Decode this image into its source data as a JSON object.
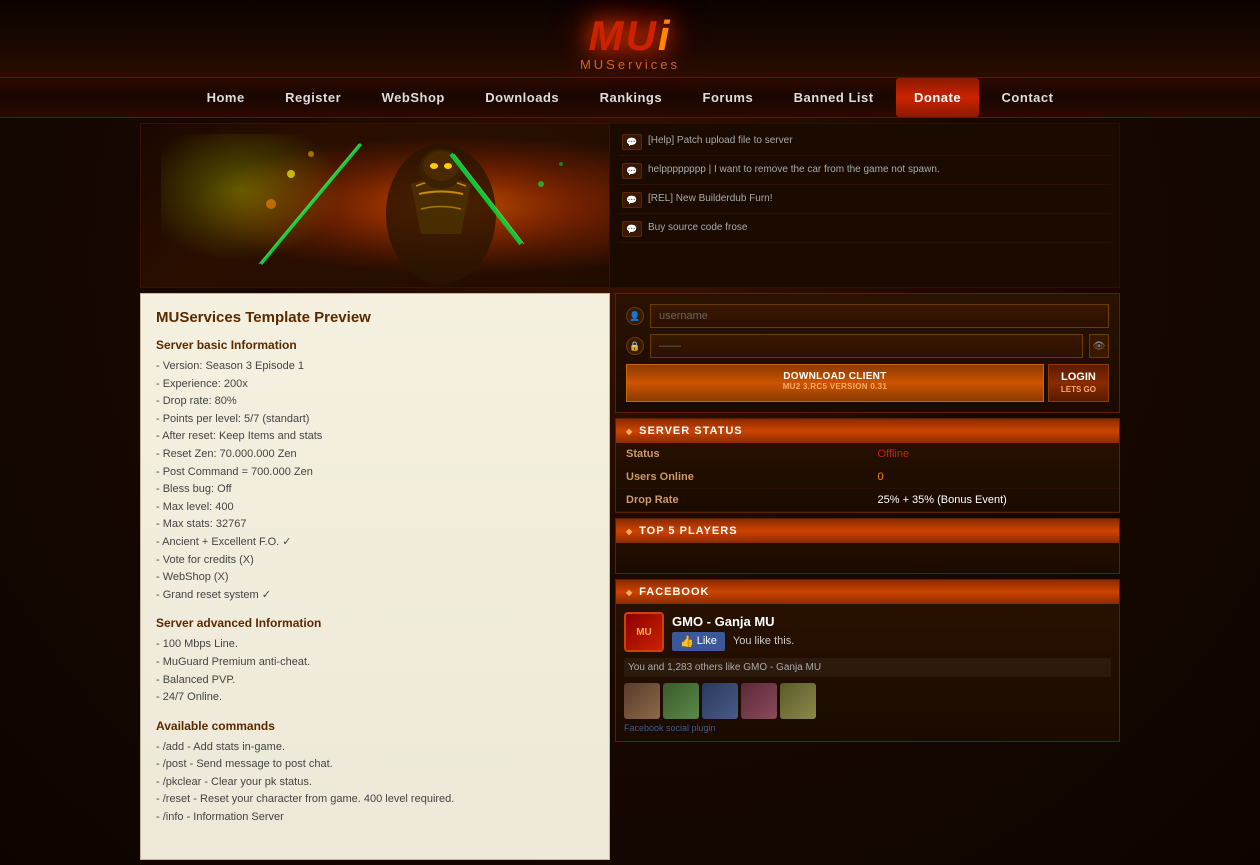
{
  "site": {
    "logo_main": "MU",
    "logo_char": "i",
    "logo_subtitle": "MUServices"
  },
  "nav": {
    "items": [
      {
        "label": "Home",
        "active": false
      },
      {
        "label": "Register",
        "active": false
      },
      {
        "label": "WebShop",
        "active": false
      },
      {
        "label": "Downloads",
        "active": false
      },
      {
        "label": "Rankings",
        "active": false
      },
      {
        "label": "Forums",
        "active": false
      },
      {
        "label": "Banned List",
        "active": false
      },
      {
        "label": "Donate",
        "active": true
      },
      {
        "label": "Contact",
        "active": false
      }
    ]
  },
  "chat": {
    "items": [
      {
        "text": "[Help] Patch upload file to server"
      },
      {
        "text": "helpppppppp | I want to remove the car from the game not spawn."
      },
      {
        "text": "[REL] New Builderdub Furn!"
      },
      {
        "text": "Buy source code frose"
      }
    ]
  },
  "main": {
    "title": "MUServices Template Preview",
    "server_basic_title": "Server basic Information",
    "server_basic_info": "- Version: Season 3 Episode 1\n- Experience: 200x\n- Drop rate: 80%\n- Points per level: 5/7 (standart)\n- After reset: Keep Items and stats\n- Reset Zen: 70.000.000 Zen\n- Post Command = 700.000 Zen\n- Bless bug: Off\n- Max level: 400\n- Max stats: 32767\n- Ancient + Excellent F.O. ✓\n- Vote for credits (X)\n- WebShop (X)\n- Grand reset system ✓",
    "server_advanced_title": "Server advanced Information",
    "server_advanced_info": "- 100 Mbps Line.\n- MuGuard Premium anti-cheat.\n- Balanced PVP.\n- 24/7 Online.",
    "available_commands_title": "Available commands",
    "available_commands": "- /add - Add stats in-game.\n- /post - Send message to post chat.\n- /pkclear - Clear your pk status.\n- /reset - Reset your character from game. 400 level required.\n- /info - Information Server"
  },
  "login": {
    "username_placeholder": "username",
    "password_placeholder": "——",
    "download_label": "DOWNLOAD CLIENT",
    "download_sub": "MU2 3.RC5 VERSION 0.31",
    "login_label": "LOGIN",
    "login_sub": "LETS GO"
  },
  "server_status": {
    "header": "SERVER STATUS",
    "rows": [
      {
        "label": "Status",
        "value": "Offline",
        "class": "status-offline"
      },
      {
        "label": "Users Online",
        "value": "0",
        "class": "status-zero"
      },
      {
        "label": "Drop Rate",
        "value": "25% + 35% (Bonus Event)",
        "class": ""
      }
    ]
  },
  "top5": {
    "header": "TOP 5 PLAYERS"
  },
  "facebook": {
    "header": "FACEBOOK",
    "page_name": "GMO - Ganja MU",
    "like_label": "Like",
    "like_text": "You like this.",
    "description": "You and 1,283 others like GMO - Ganja MU",
    "plugin_label": "Facebook social plugin"
  }
}
